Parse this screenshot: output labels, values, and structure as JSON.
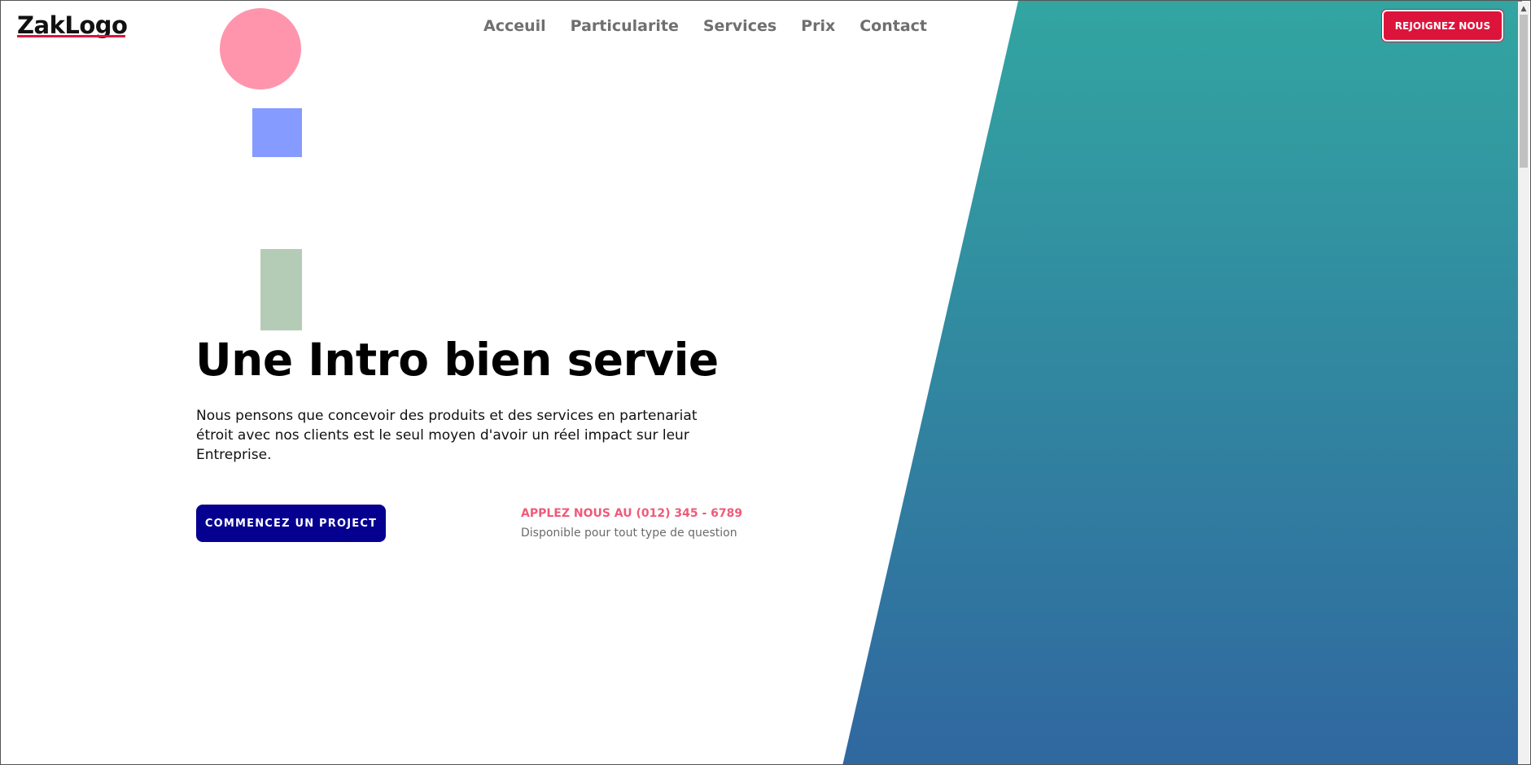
{
  "brand": {
    "logo_text": "ZakLogo"
  },
  "nav": {
    "items": [
      "Acceuil",
      "Particularite",
      "Services",
      "Prix",
      "Contact"
    ]
  },
  "header": {
    "join_label": "REJOIGNEZ NOUS"
  },
  "hero": {
    "title": "Une Intro bien servie",
    "text": "Nous pensons que concevoir des produits et des services en partenariat étroit avec nos clients est le seul moyen d'avoir un réel impact sur leur Entreprise.",
    "cta_label": "COMMENCEZ UN PROJECT",
    "call_line": "APPLEZ NOUS AU (012) 345 - 6789",
    "call_sub": "Disponible pour tout type de question"
  },
  "colors": {
    "accent_red": "#dc143c",
    "cta_blue": "#05008f",
    "phone_pink": "#ef5a79",
    "gradient_top": "#32a5a1",
    "gradient_bottom": "#3067a0",
    "circle_pink": "#ff95ad",
    "square_blue": "#869bff",
    "rect_green": "#b4ccb5"
  },
  "scrollbar": {
    "arrow_icon": "chevron-up-icon"
  }
}
